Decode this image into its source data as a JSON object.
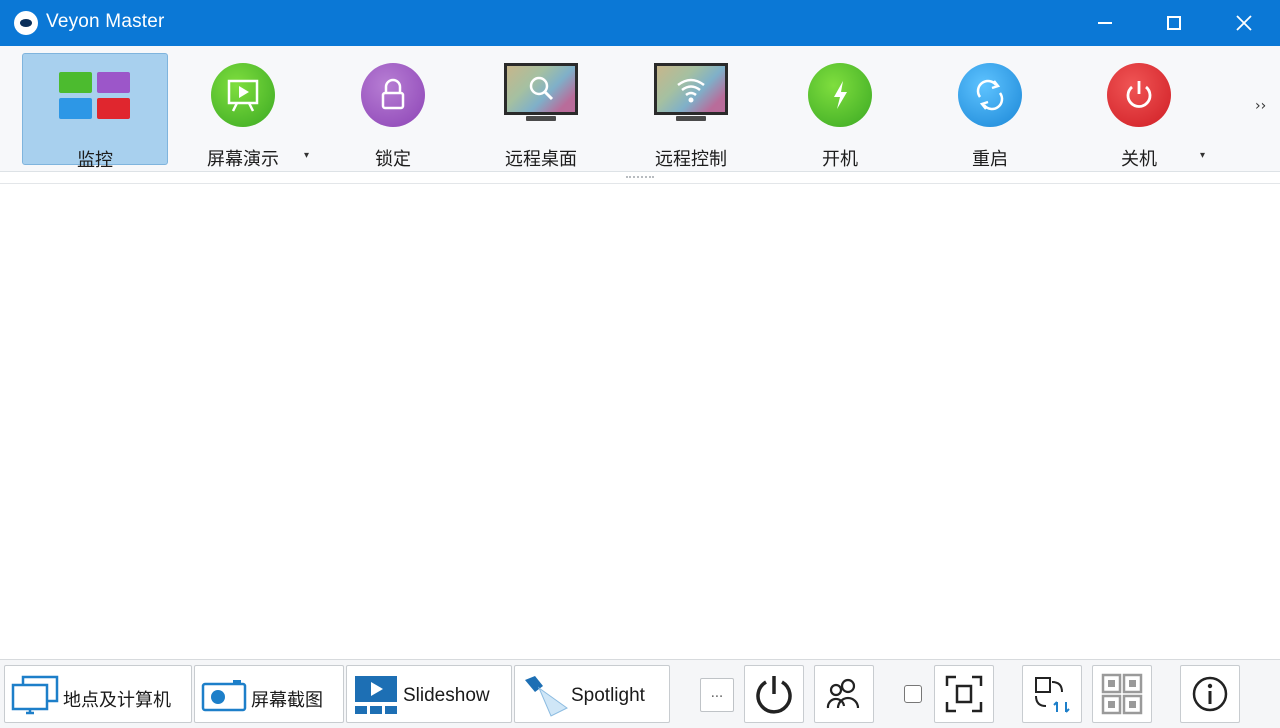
{
  "window": {
    "title": "Veyon Master"
  },
  "toolbar": {
    "items": [
      {
        "label": "监控",
        "icon": "monitoring-tiles-icon"
      },
      {
        "label": "屏幕演示",
        "icon": "screen-presentation-icon"
      },
      {
        "label": "锁定",
        "icon": "lock-icon"
      },
      {
        "label": "远程桌面",
        "icon": "remote-view-icon"
      },
      {
        "label": "远程控制",
        "icon": "remote-control-icon"
      },
      {
        "label": "开机",
        "icon": "power-on-icon"
      },
      {
        "label": "重启",
        "icon": "reboot-icon"
      },
      {
        "label": "关机",
        "icon": "power-off-icon"
      }
    ],
    "overflow": "››",
    "dropdown_marker": "▾"
  },
  "bottombar": {
    "locations_label": "地点及计算机",
    "screenshot_label": "屏幕截图",
    "slideshow_label": "Slideshow",
    "spotlight_label": "Spotlight",
    "more_label": "..."
  },
  "colors": {
    "titlebar": "#0b78d6",
    "active_tool": "#a8d0ee",
    "green": "#3aa823",
    "purple": "#8c43b5",
    "blue": "#1a86d6",
    "red": "#cf1d24"
  }
}
